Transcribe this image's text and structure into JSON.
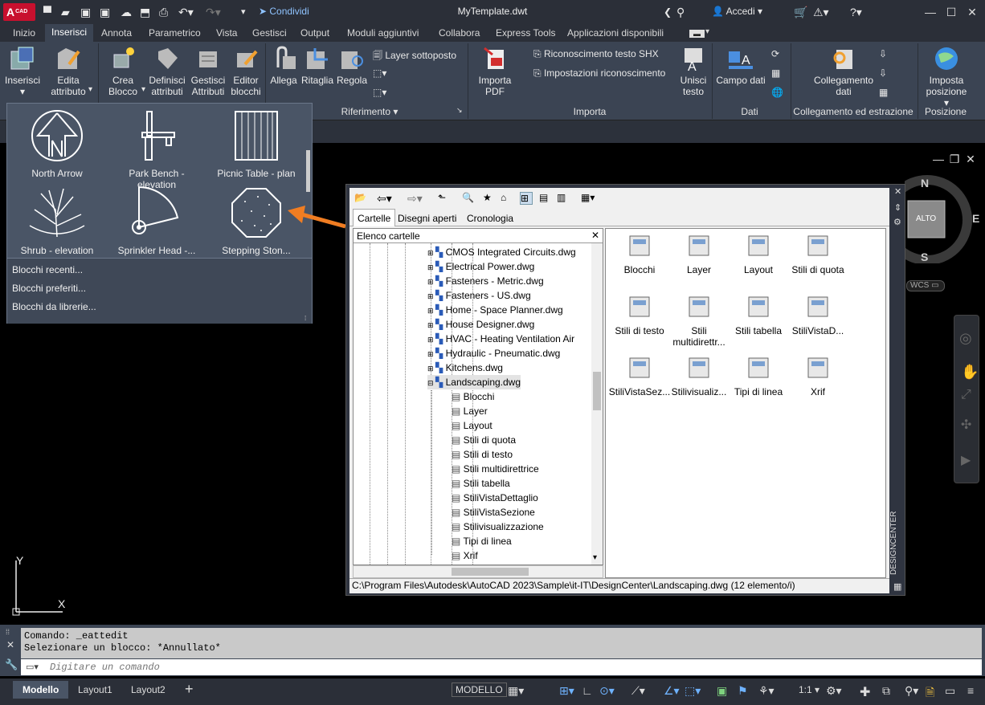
{
  "window": {
    "logo_text": "A",
    "logo_sub": "CAD",
    "share_label": "Condividi",
    "title": "MyTemplate.dwt",
    "login_label": "Accedi"
  },
  "ribbon_tabs": [
    "Inizio",
    "Inserisci",
    "Annota",
    "Parametrico",
    "Vista",
    "Gestisci",
    "Output",
    "Moduli aggiuntivi",
    "Collabora",
    "Express Tools",
    "Applicazioni disponibili"
  ],
  "ribbon": {
    "insert": "Inserisci",
    "edit_attr": "Edita\nattributo",
    "create_block": "Crea\nBlocco",
    "define_attr": "Definisci\nattributi",
    "manage_attr": "Gestisci\nAttributi",
    "block_editor": "Editor\nblocchi",
    "attach": "Allega",
    "clip": "Ritaglia",
    "adjust": "Regola",
    "underlay_layers": "Layer sottoposto",
    "ref_panel": "Riferimento",
    "import_pdf": "Importa\nPDF",
    "shx_recog": "Riconoscimento testo SHX",
    "recog_settings": "Impostazioni riconoscimento",
    "combine_text": "Unisci\ntesto",
    "import_panel": "Importa",
    "data_field": "Campo dati",
    "data_panel": "Dati",
    "data_link": "Collegamento\ndati",
    "link_panel": "Collegamento ed estrazione",
    "set_location": "Imposta\nposizione",
    "location_panel": "Posizione"
  },
  "gallery": {
    "items": [
      "North Arrow",
      "Park Bench - elevation",
      "Picnic Table - plan",
      "Shrub - elevation",
      "Sprinkler Head -...",
      "Stepping Ston..."
    ],
    "menu": [
      "Blocchi recenti...",
      "Blocchi preferiti...",
      "Blocchi da librerie..."
    ]
  },
  "designcenter": {
    "tabs": [
      "Cartelle",
      "Disegni aperti",
      "Cronologia"
    ],
    "tree_header": "Elenco cartelle",
    "files": [
      "CMOS Integrated Circuits.dwg",
      "Electrical Power.dwg",
      "Fasteners - Metric.dwg",
      "Fasteners - US.dwg",
      "Home - Space Planner.dwg",
      "House Designer.dwg",
      "HVAC - Heating Ventilation Air",
      "Hydraulic - Pneumatic.dwg",
      "Kitchens.dwg",
      "Landscaping.dwg"
    ],
    "children": [
      "Blocchi",
      "Layer",
      "Layout",
      "Stili di quota",
      "Stili di testo",
      "Stili multidirettrice",
      "Stili tabella",
      "StiliVistaDettaglio",
      "StiliVistaSezione",
      "Stilivisualizzazione",
      "Tipi di linea",
      "Xrif"
    ],
    "content": [
      "Blocchi",
      "Layer",
      "Layout",
      "Stili di quota",
      "Stili di testo",
      "Stili\nmultidirettr...",
      "Stili tabella",
      "StiliVistaD...",
      "StiliVistaSez...",
      "Stilivisualiz...",
      "Tipi di linea",
      "Xrif"
    ],
    "status": "C:\\Program Files\\Autodesk\\AutoCAD 2023\\Sample\\it-IT\\DesignCenter\\Landscaping.dwg (12 elemento/i)",
    "side_title": "DESIGNCENTER"
  },
  "viewcube": {
    "n": "N",
    "e": "E",
    "s": "S",
    "top": "ALTO",
    "wcs": "WCS"
  },
  "ucs": {
    "y": "Y",
    "x": "X"
  },
  "command": {
    "line1": "Comando: _eattedit",
    "line2": "Selezionare un blocco: *Annullato*",
    "placeholder": "Digitare un comando"
  },
  "status": {
    "layout_tabs": [
      "Modello",
      "Layout1",
      "Layout2"
    ],
    "add": "+",
    "model": "MODELLO",
    "scale": "1:1"
  },
  "colors": {
    "accent": "#f07d22",
    "brand": "#c8102e",
    "ribbon": "#3b4453"
  }
}
